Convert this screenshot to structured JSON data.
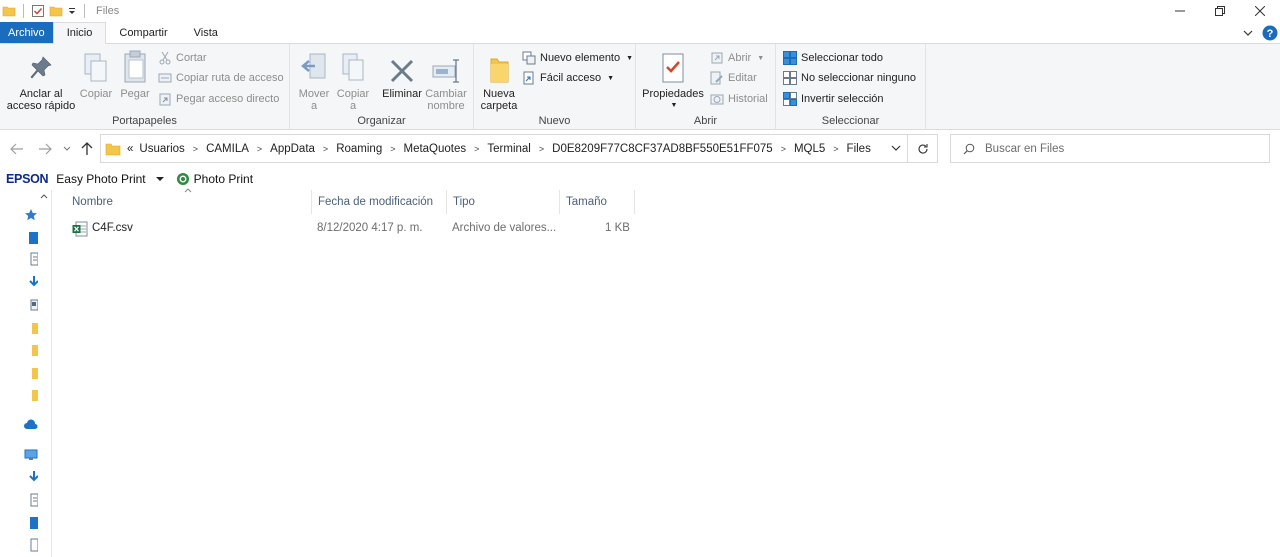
{
  "window": {
    "title": "Files"
  },
  "tabs": {
    "file": "Archivo",
    "home": "Inicio",
    "share": "Compartir",
    "view": "Vista"
  },
  "ribbon": {
    "clipboard": {
      "label": "Portapapeles",
      "pin_line1": "Anclar al",
      "pin_line2": "acceso rápido",
      "copy": "Copiar",
      "paste": "Pegar",
      "cut": "Cortar",
      "copy_path": "Copiar ruta de acceso",
      "paste_shortcut": "Pegar acceso directo"
    },
    "organize": {
      "label": "Organizar",
      "move_line1": "Mover",
      "move_line2": "a",
      "copy_line1": "Copiar",
      "copy_line2": "a",
      "delete": "Eliminar",
      "rename_line1": "Cambiar",
      "rename_line2": "nombre"
    },
    "new": {
      "label": "Nuevo",
      "folder_line1": "Nueva",
      "folder_line2": "carpeta",
      "new_item": "Nuevo elemento",
      "easy_access": "Fácil acceso"
    },
    "open": {
      "label": "Abrir",
      "properties": "Propiedades",
      "open": "Abrir",
      "edit": "Editar",
      "history": "Historial"
    },
    "select": {
      "label": "Seleccionar",
      "select_all": "Seleccionar todo",
      "select_none": "No seleccionar ninguno",
      "invert": "Invertir selección"
    }
  },
  "address": {
    "prefix": "«",
    "crumbs": [
      "Usuarios",
      "CAMILA",
      "AppData",
      "Roaming",
      "MetaQuotes",
      "Terminal",
      "D0E8209F77C8CF37AD8BF550E51FF075",
      "MQL5",
      "Files"
    ]
  },
  "search": {
    "placeholder": "Buscar en Files"
  },
  "epson": {
    "logo": "EPSON",
    "easy_photo_print": "Easy Photo Print",
    "photo_print": "Photo Print"
  },
  "columns": {
    "name": "Nombre",
    "date": "Fecha de modificación",
    "type": "Tipo",
    "size": "Tamaño"
  },
  "files": [
    {
      "name": "C4F.csv",
      "date": "8/12/2020 4:17 p. m.",
      "type": "Archivo de valores...",
      "size": "1 KB"
    }
  ],
  "colors": {
    "accent": "#1a6dbd",
    "folder": "#f3c54a",
    "excel": "#1e7145"
  }
}
